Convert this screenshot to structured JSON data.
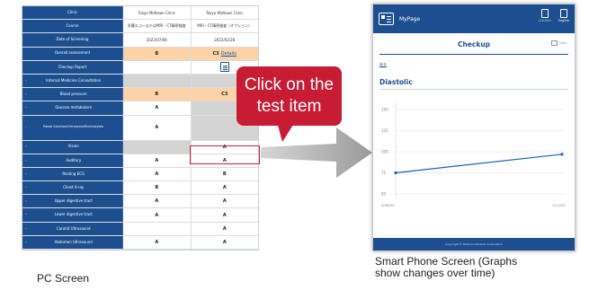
{
  "pc_screen": {
    "caption": "PC Screen",
    "header_row": {
      "label": "Clinic",
      "values": [
        "Tokyo Midtown Clinic",
        "Tokyo Midtown Clinic"
      ]
    },
    "rows": [
      {
        "label": "Course",
        "values": [
          "肝臓エコーまたはMRI・CT精密検査",
          "MRI・CT精密検査（オプション）"
        ],
        "style": ""
      },
      {
        "label": "Date of Screening",
        "values": [
          "2022/07/06",
          "2022/02/28"
        ],
        "style": ""
      },
      {
        "label": "Overall assessment",
        "values": [
          "B",
          "C3"
        ],
        "extra": [
          "",
          "Details"
        ],
        "style": "orange"
      },
      {
        "label": "Checkup Report",
        "values": [
          "",
          ""
        ],
        "style": "report"
      },
      {
        "label": "Internal Medicine Consultation",
        "values": [
          "",
          ""
        ],
        "style": "gray"
      },
      {
        "label": "Blood pressure",
        "values": [
          "B",
          "C3"
        ],
        "style": "orange"
      },
      {
        "label": "Glucose metabolism",
        "values": [
          "A",
          ""
        ],
        "style": ""
      },
      {
        "label": "Renal function/Urinalysis/Electrolytes",
        "values": [
          "A",
          ""
        ],
        "style": "tall"
      },
      {
        "label": "Vision",
        "values": [
          "",
          "A"
        ],
        "style": "vision"
      },
      {
        "label": "Auditory",
        "values": [
          "A",
          "A"
        ],
        "style": ""
      },
      {
        "label": "Resting ECG",
        "values": [
          "A",
          "B"
        ],
        "style": ""
      },
      {
        "label": "Chest X-ray",
        "values": [
          "B",
          "A"
        ],
        "style": ""
      },
      {
        "label": "Upper digestive tract",
        "values": [
          "A",
          "A"
        ],
        "style": ""
      },
      {
        "label": "Lower digestive tract",
        "values": [
          "A",
          "A"
        ],
        "style": ""
      },
      {
        "label": "Carotid Ultrasound",
        "values": [
          "",
          "A"
        ],
        "style": ""
      },
      {
        "label": "Abdomen Ultrasound",
        "values": [
          "A",
          "A"
        ],
        "style": ""
      }
    ]
  },
  "callout": {
    "line1": "Click on the",
    "line2": "test item"
  },
  "phone": {
    "caption_line1": "Smart Phone Screen (Graphs",
    "caption_line2": "show changes over time)",
    "app_title": "MyPage",
    "action_1": "Link/Ack",
    "action_2": "English",
    "page_title": "Checkup",
    "save_label": "Save",
    "back_link": "戻る",
    "section_title": "Diastolic",
    "footer": "Copyright © Midtown Medical Corporation",
    "accent": "#1d4f8f"
  },
  "chart_data": {
    "type": "line",
    "title": "",
    "xlabel": "",
    "ylabel": "",
    "x": [
      "2/28/20",
      "11/7/22"
    ],
    "series": [
      {
        "values": [
          75,
          97
        ]
      }
    ],
    "yticks": [
      150,
      125,
      100,
      75,
      50
    ],
    "ylim": [
      0,
      150
    ],
    "grid": true,
    "color": "#1f62b5"
  }
}
